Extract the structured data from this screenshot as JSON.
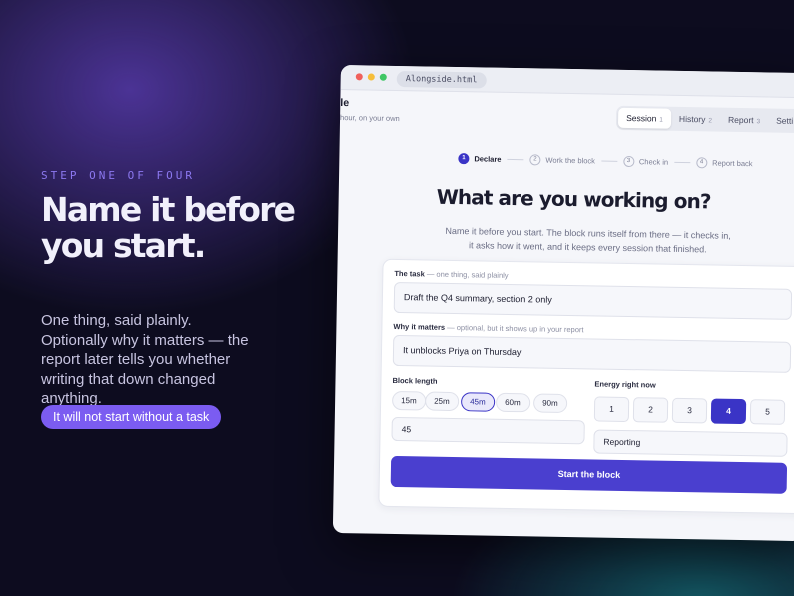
{
  "hero": {
    "eyebrow": "STEP ONE OF FOUR",
    "headline": "Name it before you start.",
    "subtext": "One thing, said plainly. Optionally why it matters — the report later tells you whether writing that down changed anything.",
    "pill": "It will not start without a task"
  },
  "window": {
    "url_tab": "Alongside.html",
    "app_title": "le",
    "app_subtitle": "hour, on your own",
    "tabs": [
      {
        "label": "Session",
        "num": "1"
      },
      {
        "label": "History",
        "num": "2"
      },
      {
        "label": "Report",
        "num": "3"
      },
      {
        "label": "Setti",
        "num": ""
      }
    ]
  },
  "steps": [
    {
      "num": "1",
      "label": "Declare"
    },
    {
      "num": "2",
      "label": "Work the block"
    },
    {
      "num": "3",
      "label": "Check in"
    },
    {
      "num": "4",
      "label": "Report back"
    }
  ],
  "main": {
    "title": "What are you working on?",
    "description": "Name it before you start. The block runs itself from there — it checks in, it asks how it went, and it keeps every session that finished."
  },
  "form": {
    "task_label": "The task",
    "task_hint": "— one thing, said plainly",
    "task_value": "Draft the Q4 summary, section 2 only",
    "why_label": "Why it matters",
    "why_hint": "— optional, but it shows up in your report",
    "why_value": "It unblocks Priya on Thursday",
    "block_label": "Block length",
    "block_options": [
      "15m",
      "25m",
      "45m",
      "60m",
      "90m"
    ],
    "block_selected": "45m",
    "block_value": "45",
    "energy_label": "Energy right now",
    "energy_options": [
      "1",
      "2",
      "3",
      "4",
      "5"
    ],
    "energy_selected": "4",
    "category_value": "Reporting",
    "start_label": "Start the block"
  },
  "colors": {
    "accent": "#3a34c6",
    "pill": "#7b5cf1",
    "background": "#0d0c1f"
  }
}
